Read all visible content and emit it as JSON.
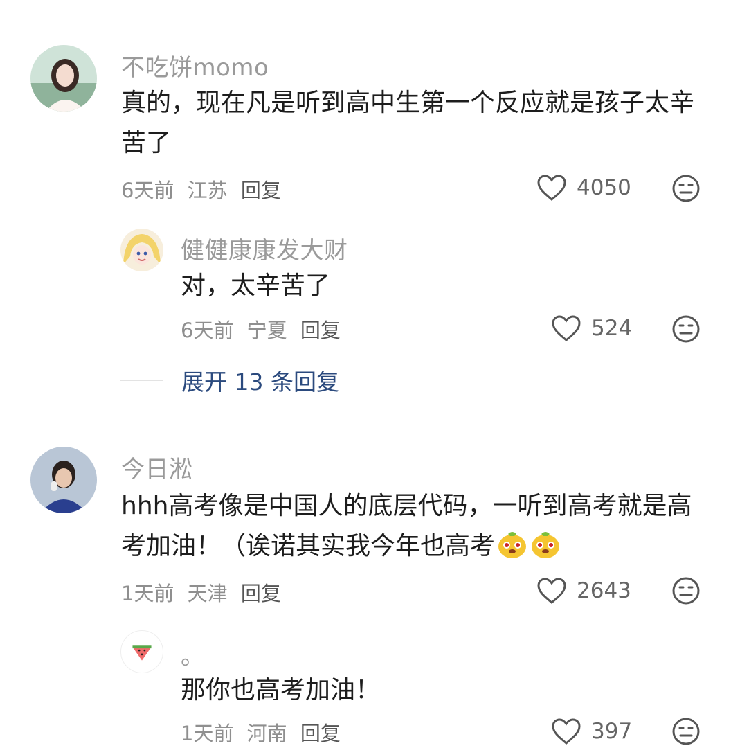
{
  "comments": [
    {
      "username": "不吃饼momo",
      "text": "真的，现在凡是听到高中生第一个反应就是孩子太辛苦了",
      "time": "6天前",
      "location": "江苏",
      "reply_label": "回复",
      "likes": "4050",
      "replies": [
        {
          "username": "健健康康发大财",
          "text": "对，太辛苦了",
          "time": "6天前",
          "location": "宁夏",
          "reply_label": "回复",
          "likes": "524"
        }
      ],
      "expand_label": "展开 13 条回复"
    },
    {
      "username": "今日淞",
      "text": "hhh高考像是中国人的底层代码，一听到高考就是高考加油！（诶诺其实我今年也高考",
      "time": "1天前",
      "location": "天津",
      "reply_label": "回复",
      "likes": "2643",
      "replies": [
        {
          "username": "。",
          "text": "那你也高考加油！",
          "time": "1天前",
          "location": "河南",
          "reply_label": "回复",
          "likes": "397"
        }
      ]
    }
  ],
  "icons": {
    "like": "heart-outline-icon",
    "dislike": "meh-face-icon",
    "sticker": "yellow-blob-emoji"
  },
  "colors": {
    "username": "#9a9a9a",
    "body_text": "#1d1d1d",
    "meta": "#8f8f8f",
    "expand_link": "#2b4a7e"
  }
}
